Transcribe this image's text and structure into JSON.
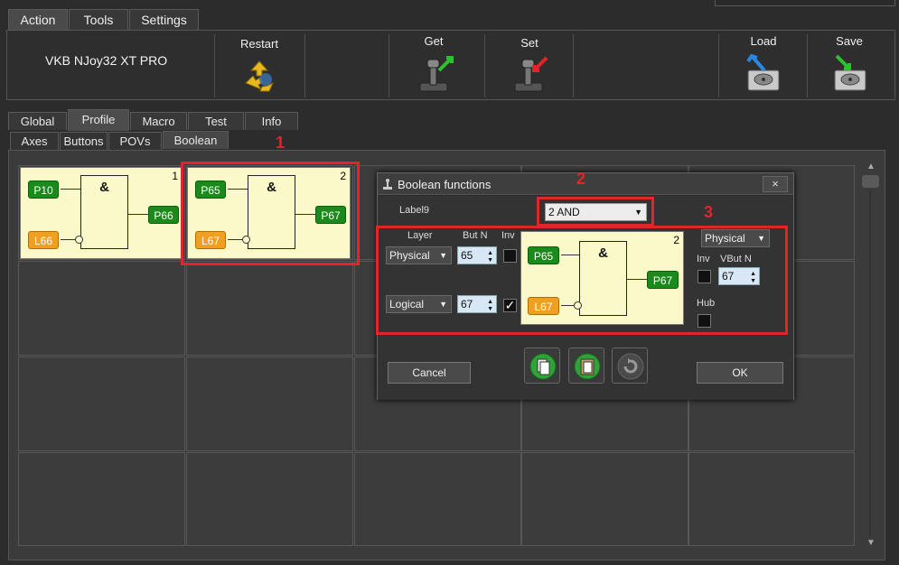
{
  "menu": {
    "tabs": [
      "Action",
      "Tools",
      "Settings"
    ]
  },
  "toolbar": {
    "device_name": "VKB NJoy32 XT PRO",
    "restart_label": "Restart",
    "get_label": "Get",
    "set_label": "Set",
    "load_label": "Load",
    "save_label": "Save"
  },
  "tabs_main": [
    "Global",
    "Profile",
    "Macro",
    "Test",
    "Info"
  ],
  "tabs_sub": [
    "Axes",
    "Buttons",
    "POVs",
    "Boolean"
  ],
  "grid": {
    "cell1": {
      "number": "1",
      "in1": "P10",
      "in2": "L66",
      "out": "P66",
      "op": "&"
    },
    "cell2": {
      "number": "2",
      "in1": "P65",
      "in2": "L67",
      "out": "P67",
      "op": "&"
    }
  },
  "annotations": {
    "n1": "1",
    "n2": "2",
    "n3": "3"
  },
  "dialog": {
    "title": "Boolean functions",
    "close": "×",
    "label9": "Label9",
    "function_select": "2 AND",
    "col_layer": "Layer",
    "col_butn": "But N",
    "col_inv": "Inv",
    "row1": {
      "layer": "Physical",
      "butn": "65",
      "inv": ""
    },
    "row2": {
      "layer": "Logical",
      "butn": "67",
      "inv": "✓"
    },
    "preview": {
      "number": "2",
      "in1": "P65",
      "in2": "L67",
      "out": "P67",
      "op": "&"
    },
    "out_layer": "Physical",
    "out_inv_label": "Inv",
    "out_vbutn_label": "VBut N",
    "out_vbutn": "67",
    "hub_label": "Hub",
    "cancel": "Cancel",
    "ok": "OK"
  }
}
